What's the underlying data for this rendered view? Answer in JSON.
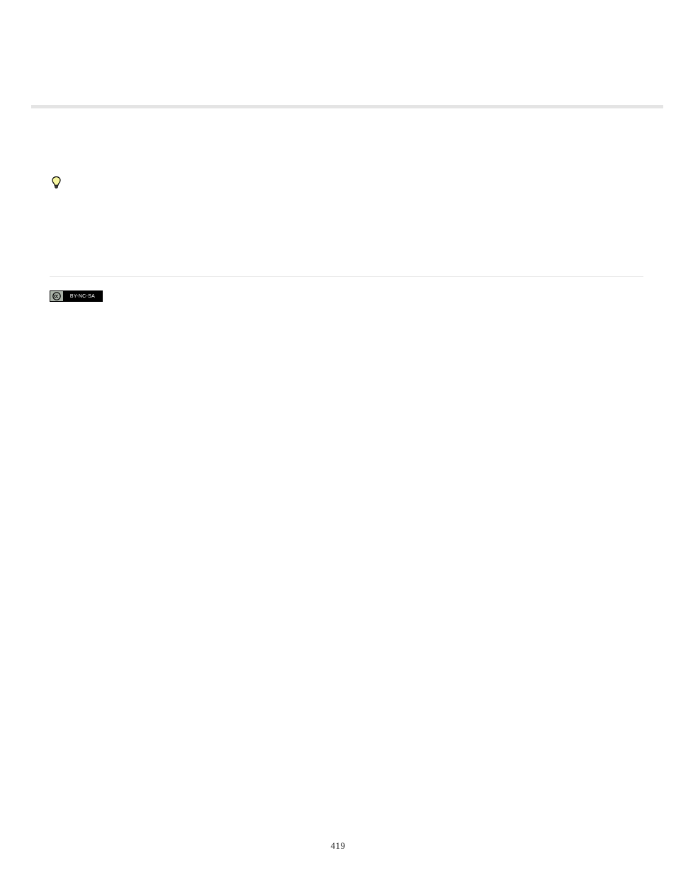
{
  "icons": {
    "tip_label": "tip",
    "cc_left": "cc",
    "cc_right": "BY-NC-SA"
  },
  "page_number": "419"
}
